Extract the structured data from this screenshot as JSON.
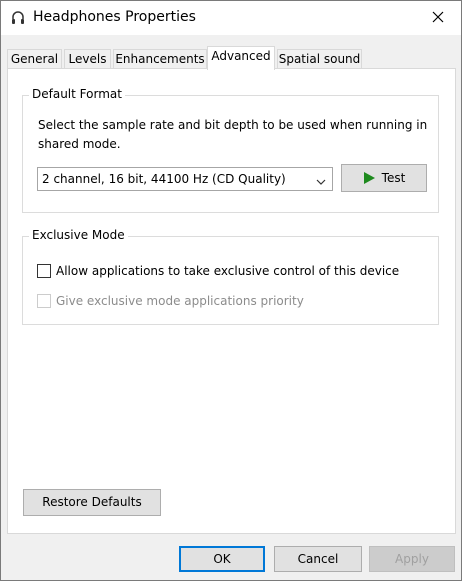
{
  "window": {
    "title": "Headphones Properties",
    "close_icon": "close-icon"
  },
  "tabs": [
    {
      "label": "General"
    },
    {
      "label": "Levels"
    },
    {
      "label": "Enhancements"
    },
    {
      "label": "Advanced",
      "active": true
    },
    {
      "label": "Spatial sound"
    }
  ],
  "default_format": {
    "title": "Default Format",
    "description": "Select the sample rate and bit depth to be used when running in shared mode.",
    "selected_format": "2 channel, 16 bit, 44100 Hz (CD Quality)",
    "test_label": "Test"
  },
  "exclusive_mode": {
    "title": "Exclusive Mode",
    "allow_label": "Allow applications to take exclusive control of this device",
    "allow_checked": false,
    "priority_label": "Give exclusive mode applications priority",
    "priority_checked": false,
    "priority_disabled": true
  },
  "restore_defaults_label": "Restore Defaults",
  "footer": {
    "ok_label": "OK",
    "cancel_label": "Cancel",
    "apply_label": "Apply"
  },
  "colors": {
    "accent": "#0078d7",
    "play_green": "#1e8a1e"
  }
}
